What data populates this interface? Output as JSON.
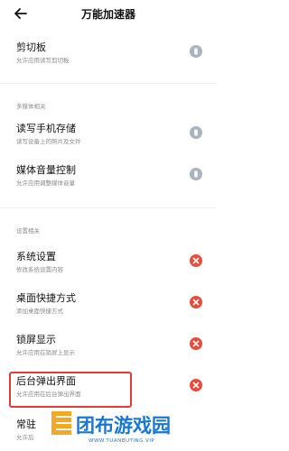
{
  "header": {
    "title": "万能加速器"
  },
  "sections": {
    "multimedia": "多媒体相关",
    "settings": "设置相关"
  },
  "permissions": [
    {
      "title": "剪切板",
      "subtitle": "允许应用读写剪切板",
      "status": "allowed",
      "color": "#a9b4bf"
    },
    {
      "title": "读写手机存储",
      "subtitle": "读写设备上的照片及文件",
      "status": "allowed",
      "color": "#a9b4bf"
    },
    {
      "title": "媒体音量控制",
      "subtitle": "允许应用调整媒体音量",
      "status": "allowed",
      "color": "#a9b4bf"
    },
    {
      "title": "系统设置",
      "subtitle": "修改系统设置内容",
      "status": "denied",
      "color": "#e74c3c"
    },
    {
      "title": "桌面快捷方式",
      "subtitle": "添加桌面快捷方式",
      "status": "denied",
      "color": "#e74c3c"
    },
    {
      "title": "锁屏显示",
      "subtitle": "允许应用在锁屏上显示",
      "status": "denied",
      "color": "#e74c3c"
    },
    {
      "title": "后台弹出界面",
      "subtitle": "允许应用在后台弹出界面",
      "status": "denied",
      "color": "#e74c3c"
    },
    {
      "title": "常驻",
      "subtitle": "允许后",
      "status": "unknown"
    }
  ],
  "watermark": {
    "name": "团布游戏园",
    "url": "WWW.TUANBUTING.VIP"
  },
  "colors": {
    "highlight": "#e53935",
    "brand": "#1678d6"
  }
}
